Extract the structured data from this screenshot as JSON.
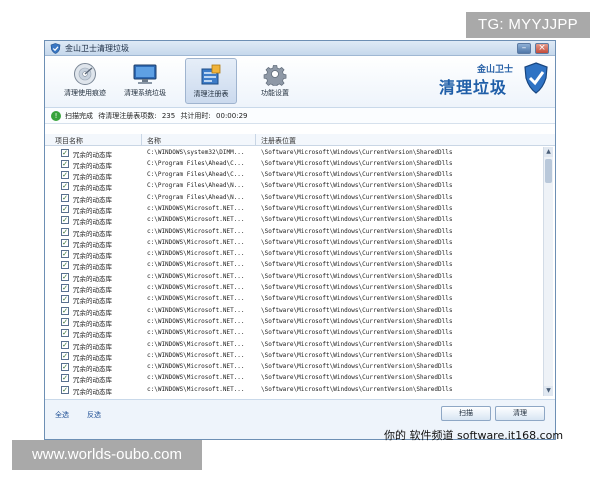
{
  "watermarks": {
    "top": "TG: MYYJJPP",
    "bottom": "www.worlds-oubo.com",
    "site": "你的 软件频道 software.it168.com"
  },
  "window": {
    "title": "金山卫士清理垃圾",
    "minimize": "–",
    "close": "×"
  },
  "toolbar": {
    "items": [
      {
        "label": "清理使用痕迹",
        "icon": "disc-icon"
      },
      {
        "label": "清理系统垃圾",
        "icon": "monitor-icon"
      },
      {
        "label": "清理注册表",
        "icon": "registry-icon"
      },
      {
        "label": "功能设置",
        "icon": "gear-icon"
      }
    ],
    "active_index": 2
  },
  "brand": {
    "small": "金山卫士",
    "big": "清理垃圾"
  },
  "status": {
    "done": "扫描完成",
    "pending_label": "待清理注册表项数:",
    "pending_count": "235",
    "time_label": "共计用时:",
    "time_value": "00:00:29"
  },
  "table": {
    "headers": [
      "项目名称",
      "名称",
      "注册表位置"
    ],
    "rows": [
      {
        "item": "冗余的动态库",
        "name": "C:\\WINDOWS\\system32\\DIMM...",
        "location": "\\Software\\Microsoft\\Windows\\CurrentVersion\\SharedDlls"
      },
      {
        "item": "冗余的动态库",
        "name": "C:\\Program Files\\Ahead\\C...",
        "location": "\\Software\\Microsoft\\Windows\\CurrentVersion\\SharedDlls"
      },
      {
        "item": "冗余的动态库",
        "name": "C:\\Program Files\\Ahead\\C...",
        "location": "\\Software\\Microsoft\\Windows\\CurrentVersion\\SharedDlls"
      },
      {
        "item": "冗余的动态库",
        "name": "C:\\Program Files\\Ahead\\N...",
        "location": "\\Software\\Microsoft\\Windows\\CurrentVersion\\SharedDlls"
      },
      {
        "item": "冗余的动态库",
        "name": "C:\\Program Files\\Ahead\\N...",
        "location": "\\Software\\Microsoft\\Windows\\CurrentVersion\\SharedDlls"
      },
      {
        "item": "冗余的动态库",
        "name": "c:\\WINDOWS\\Microsoft.NET...",
        "location": "\\Software\\Microsoft\\Windows\\CurrentVersion\\SharedDlls"
      },
      {
        "item": "冗余的动态库",
        "name": "c:\\WINDOWS\\Microsoft.NET...",
        "location": "\\Software\\Microsoft\\Windows\\CurrentVersion\\SharedDlls"
      },
      {
        "item": "冗余的动态库",
        "name": "c:\\WINDOWS\\Microsoft.NET...",
        "location": "\\Software\\Microsoft\\Windows\\CurrentVersion\\SharedDlls"
      },
      {
        "item": "冗余的动态库",
        "name": "c:\\WINDOWS\\Microsoft.NET...",
        "location": "\\Software\\Microsoft\\Windows\\CurrentVersion\\SharedDlls"
      },
      {
        "item": "冗余的动态库",
        "name": "c:\\WINDOWS\\Microsoft.NET...",
        "location": "\\Software\\Microsoft\\Windows\\CurrentVersion\\SharedDlls"
      },
      {
        "item": "冗余的动态库",
        "name": "c:\\WINDOWS\\Microsoft.NET...",
        "location": "\\Software\\Microsoft\\Windows\\CurrentVersion\\SharedDlls"
      },
      {
        "item": "冗余的动态库",
        "name": "c:\\WINDOWS\\Microsoft.NET...",
        "location": "\\Software\\Microsoft\\Windows\\CurrentVersion\\SharedDlls"
      },
      {
        "item": "冗余的动态库",
        "name": "c:\\WINDOWS\\Microsoft.NET...",
        "location": "\\Software\\Microsoft\\Windows\\CurrentVersion\\SharedDlls"
      },
      {
        "item": "冗余的动态库",
        "name": "c:\\WINDOWS\\Microsoft.NET...",
        "location": "\\Software\\Microsoft\\Windows\\CurrentVersion\\SharedDlls"
      },
      {
        "item": "冗余的动态库",
        "name": "c:\\WINDOWS\\Microsoft.NET...",
        "location": "\\Software\\Microsoft\\Windows\\CurrentVersion\\SharedDlls"
      },
      {
        "item": "冗余的动态库",
        "name": "c:\\WINDOWS\\Microsoft.NET...",
        "location": "\\Software\\Microsoft\\Windows\\CurrentVersion\\SharedDlls"
      },
      {
        "item": "冗余的动态库",
        "name": "c:\\WINDOWS\\Microsoft.NET...",
        "location": "\\Software\\Microsoft\\Windows\\CurrentVersion\\SharedDlls"
      },
      {
        "item": "冗余的动态库",
        "name": "c:\\WINDOWS\\Microsoft.NET...",
        "location": "\\Software\\Microsoft\\Windows\\CurrentVersion\\SharedDlls"
      },
      {
        "item": "冗余的动态库",
        "name": "c:\\WINDOWS\\Microsoft.NET...",
        "location": "\\Software\\Microsoft\\Windows\\CurrentVersion\\SharedDlls"
      },
      {
        "item": "冗余的动态库",
        "name": "c:\\WINDOWS\\Microsoft.NET...",
        "location": "\\Software\\Microsoft\\Windows\\CurrentVersion\\SharedDlls"
      },
      {
        "item": "冗余的动态库",
        "name": "c:\\WINDOWS\\Microsoft.NET...",
        "location": "\\Software\\Microsoft\\Windows\\CurrentVersion\\SharedDlls"
      },
      {
        "item": "冗余的动态库",
        "name": "c:\\WINDOWS\\Microsoft.NET...",
        "location": "\\Software\\Microsoft\\Windows\\CurrentVersion\\SharedDlls"
      }
    ]
  },
  "scrollbar": {
    "up": "▲",
    "down": "▼"
  },
  "footer": {
    "select_all": "全选",
    "invert": "反选",
    "scan": "扫描",
    "clean": "清理"
  },
  "colors": {
    "accent": "#1f5ea8",
    "status_ok": "#37a33b",
    "frame": "#6d8fb4"
  }
}
